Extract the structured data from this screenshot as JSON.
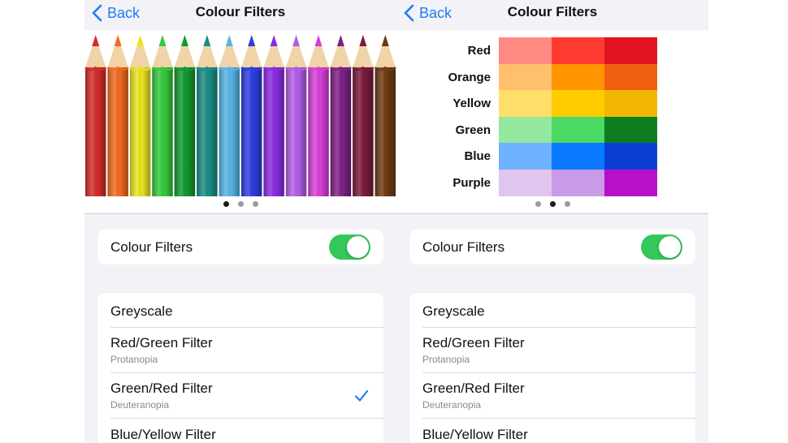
{
  "screens": [
    {
      "nav": {
        "back_label": "Back",
        "title": "Colour Filters"
      },
      "preview": {
        "kind": "pencils",
        "pencil_colors": [
          "#d42a2a",
          "#f26a1e",
          "#e9e41c",
          "#33c93a",
          "#10992f",
          "#1b8c86",
          "#57b3e6",
          "#2c3ee0",
          "#8a2be2",
          "#b15ee6",
          "#d73fd8",
          "#7e1f86",
          "#7a1a3a",
          "#6e3a12"
        ],
        "page_indicator": {
          "count": 3,
          "active": 0
        }
      },
      "toggle": {
        "label": "Colour Filters",
        "on": true
      },
      "options": [
        {
          "title": "Greyscale",
          "subtitle": "",
          "checked": false
        },
        {
          "title": "Red/Green Filter",
          "subtitle": "Protanopia",
          "checked": false
        },
        {
          "title": "Green/Red Filter",
          "subtitle": "Deuteranopia",
          "checked": true
        },
        {
          "title": "Blue/Yellow Filter",
          "subtitle": "",
          "checked": false
        }
      ]
    },
    {
      "nav": {
        "back_label": "Back",
        "title": "Colour Filters"
      },
      "preview": {
        "kind": "swatch-grid",
        "rows": [
          {
            "label": "Red",
            "colors": [
              "#ff8a84",
              "#ff3b30",
              "#e0141f"
            ]
          },
          {
            "label": "Orange",
            "colors": [
              "#ffbf6b",
              "#ff9500",
              "#f0600e"
            ]
          },
          {
            "label": "Yellow",
            "colors": [
              "#ffdf6a",
              "#ffcc00",
              "#f2b705"
            ]
          },
          {
            "label": "Green",
            "colors": [
              "#94e89e",
              "#4cd964",
              "#0b7d1f"
            ]
          },
          {
            "label": "Blue",
            "colors": [
              "#6fb2ff",
              "#0a7aff",
              "#0a3fd6"
            ]
          },
          {
            "label": "Purple",
            "colors": [
              "#e0c6ef",
              "#c99be6",
              "#b810c9"
            ]
          }
        ],
        "page_indicator": {
          "count": 3,
          "active": 1
        }
      },
      "toggle": {
        "label": "Colour Filters",
        "on": true
      },
      "options": [
        {
          "title": "Greyscale",
          "subtitle": "",
          "checked": false
        },
        {
          "title": "Red/Green Filter",
          "subtitle": "Protanopia",
          "checked": false
        },
        {
          "title": "Green/Red Filter",
          "subtitle": "Deuteranopia",
          "checked": false
        },
        {
          "title": "Blue/Yellow Filter",
          "subtitle": "",
          "checked": false
        }
      ]
    }
  ],
  "accent_color": "#1f7bf2",
  "toggle_on_color": "#34c759"
}
